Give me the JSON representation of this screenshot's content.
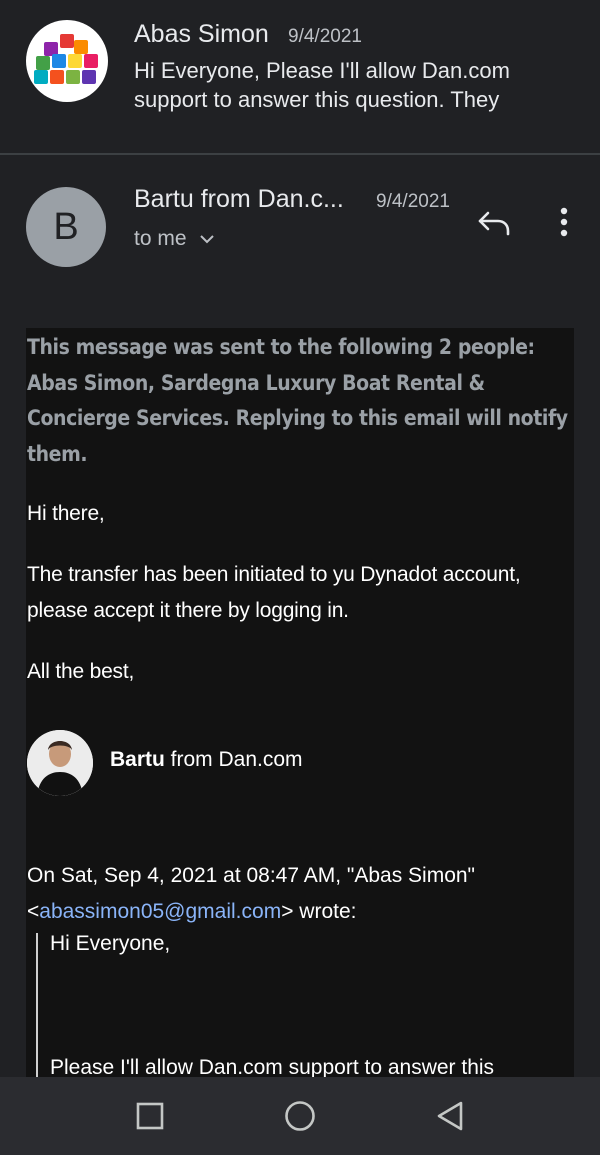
{
  "thread_item": {
    "sender": "Abas Simon",
    "date": "9/4/2021",
    "snippet": "Hi Everyone, Please I'll allow Dan.com support to answer this question. They"
  },
  "message": {
    "avatar_letter": "B",
    "sender": "Bartu from Dan.c...",
    "date": "9/4/2021",
    "recipient": "to me",
    "notice": "This message was sent to the following 2 people: Abas Simon, Sardegna Luxury Boat Rental & Concierge Services. Replying to this email will notify them.",
    "greeting": "Hi there,",
    "body": "The transfer has been initiated to yu Dynadot account, please accept it there by logging in.",
    "closing": "All the best,",
    "signature_name": "Bartu",
    "signature_rest": " from Dan.com",
    "quote_header_prefix": "On Sat, Sep 4, 2021 at 08:47 AM, \"Abas Simon\" <",
    "quote_email": "abassimon05@gmail.com",
    "quote_header_suffix": "> wrote:",
    "quote_line1": "Hi Everyone,",
    "quote_line2": "Please I'll allow Dan.com support to answer this"
  },
  "colors": {
    "background": "#202124",
    "body_background": "#121212",
    "link": "#8ab4f8",
    "muted": "#9aa0a6"
  },
  "icons": {
    "reply": "reply-icon",
    "more": "more-vert-icon",
    "expand": "chevron-down-icon",
    "nav_recents": "square-icon",
    "nav_home": "circle-icon",
    "nav_back": "triangle-back-icon"
  }
}
